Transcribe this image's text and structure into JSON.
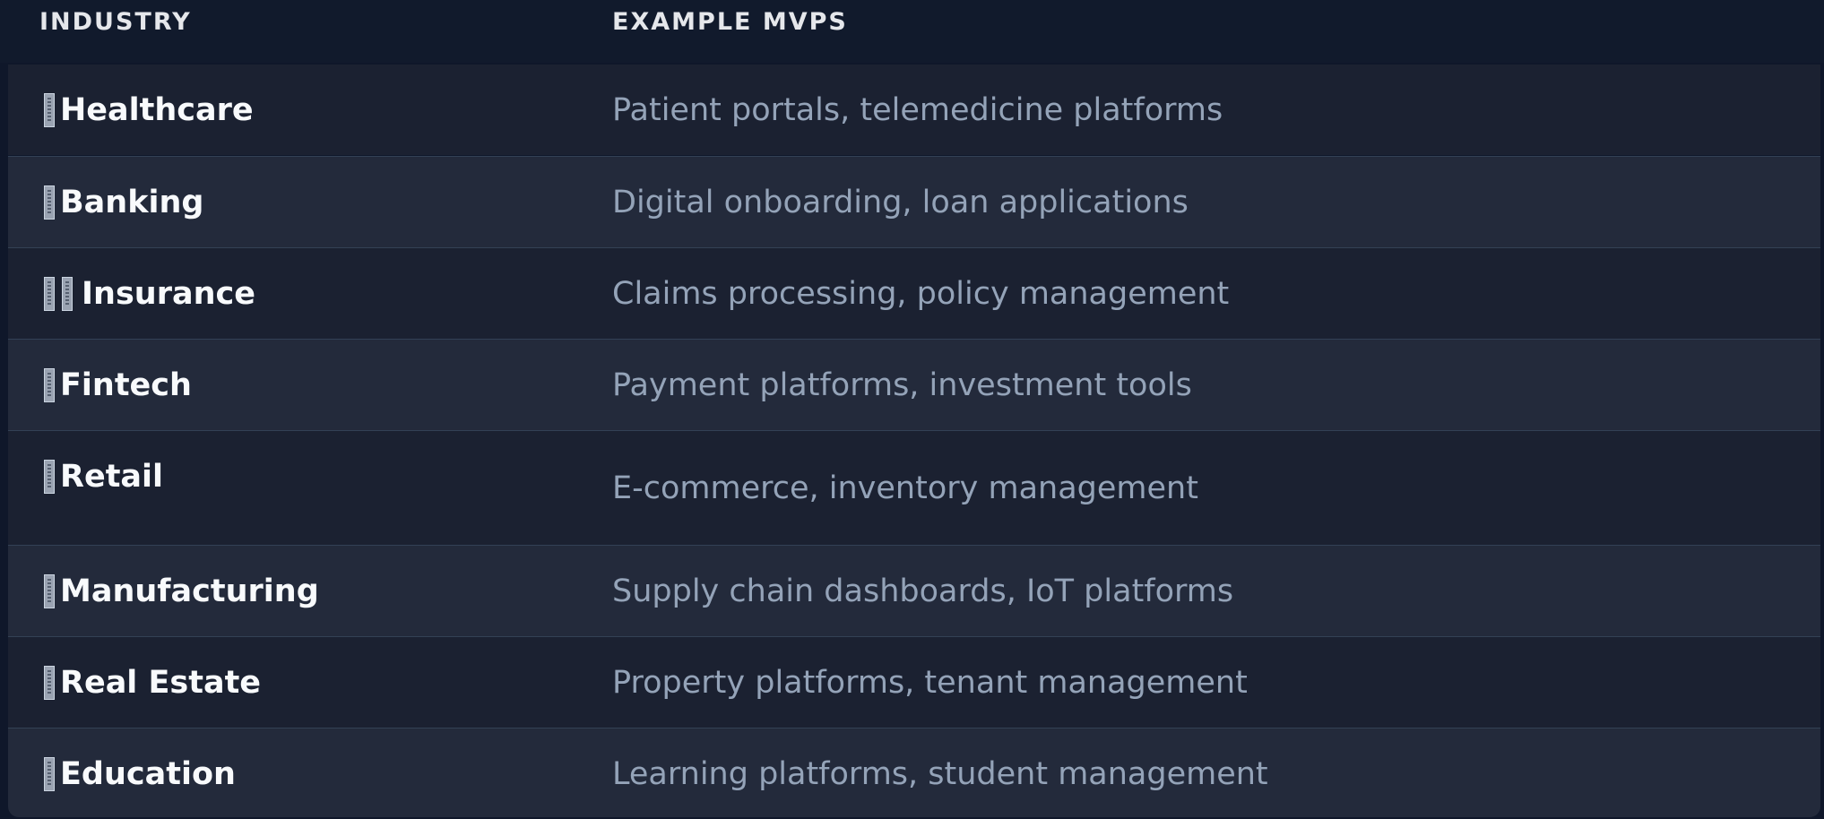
{
  "header": {
    "industry": "INDUSTRY",
    "mvps": "EXAMPLE MVPS"
  },
  "rows": [
    {
      "industry": "Healthcare",
      "mvps": "Patient portals, telemedicine platforms"
    },
    {
      "industry": "Banking",
      "mvps": "Digital onboarding, loan applications"
    },
    {
      "industry": "Insurance",
      "mvps": "Claims processing, policy management"
    },
    {
      "industry": "Fintech",
      "mvps": "Payment platforms, investment tools"
    },
    {
      "industry": "Retail",
      "mvps": "E-commerce, inventory management"
    },
    {
      "industry": "Manufacturing",
      "mvps": "Supply chain dashboards, IoT platforms"
    },
    {
      "industry": "Real Estate",
      "mvps": "Property platforms, tenant management"
    },
    {
      "industry": "Education",
      "mvps": "Learning platforms, student management"
    }
  ],
  "icons": {
    "row_emoji": "missing-emoji-glyph-icon"
  },
  "colors": {
    "page_bg": "#0f172a",
    "header_text": "#e5e7eb",
    "industry_text": "#f8fafc",
    "mvp_text": "#94a3b8",
    "row_odd": "#1b2131",
    "row_even": "#232a3b",
    "divider": "#334155"
  }
}
